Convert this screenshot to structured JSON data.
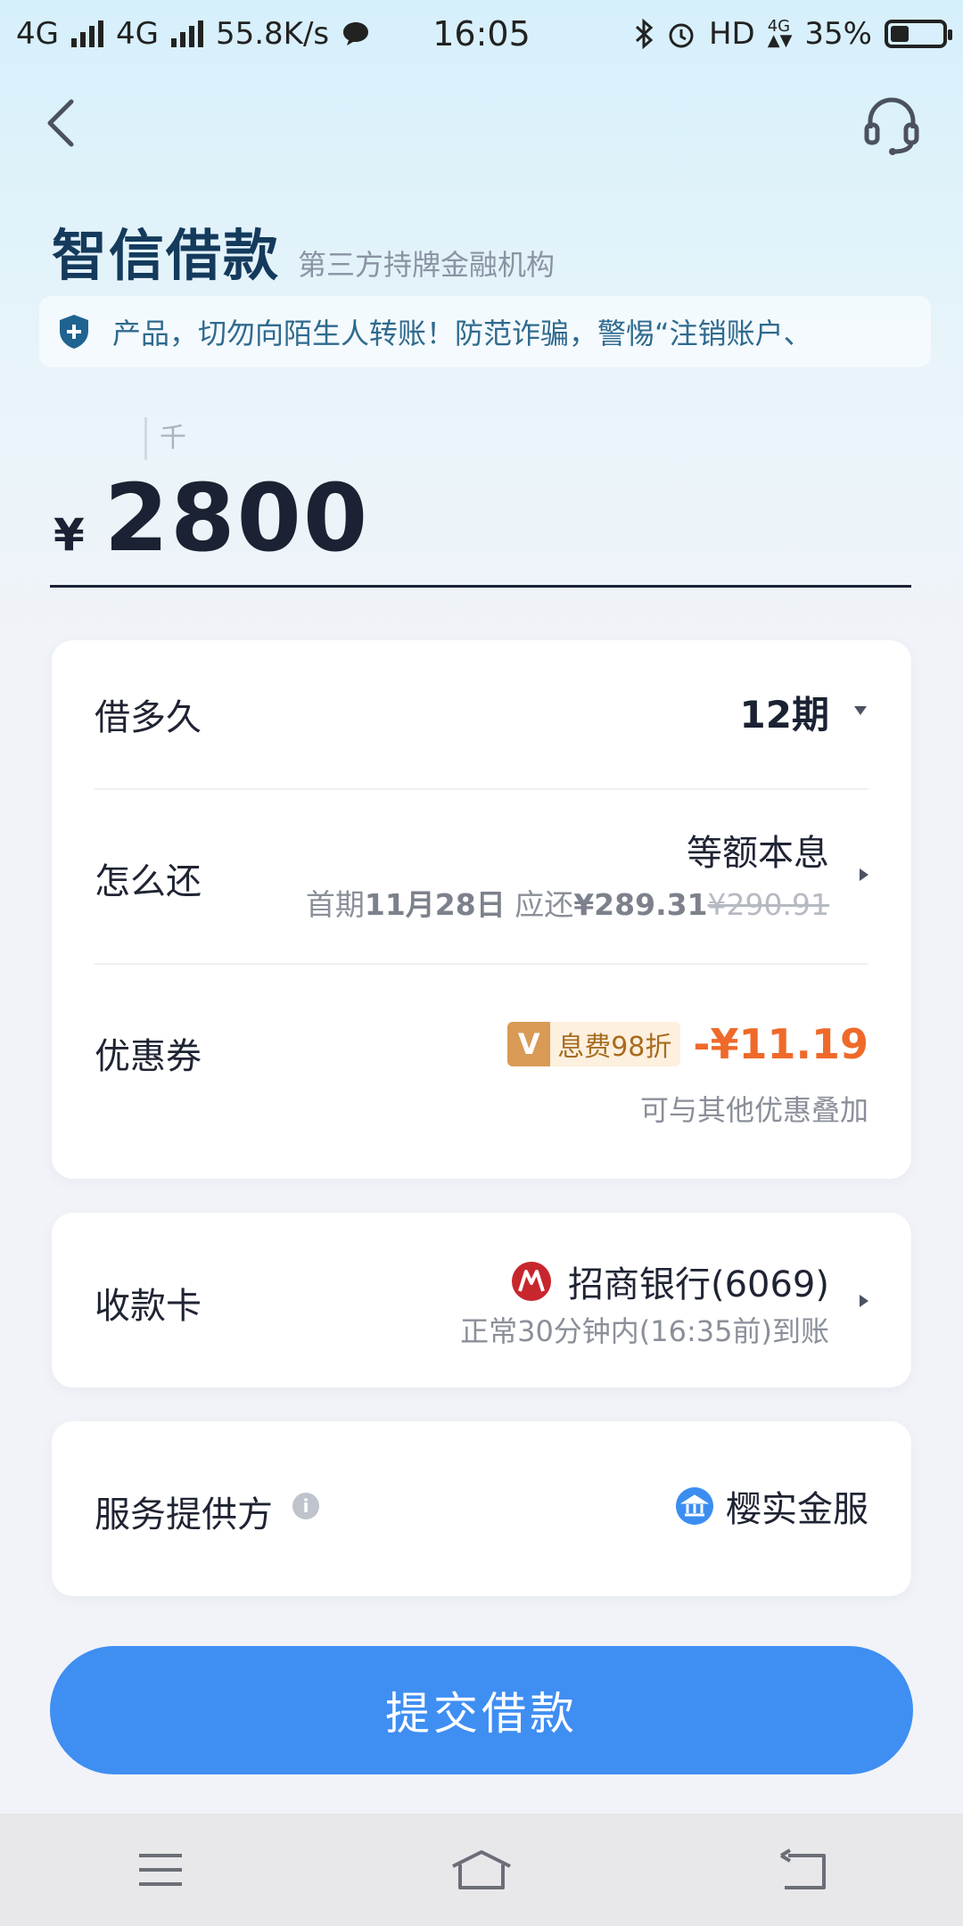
{
  "status_bar": {
    "network1": "4G",
    "network2": "4G",
    "speed": "55.8K/s",
    "time": "16:05",
    "hd": "HD",
    "battery_percent": "35%",
    "battery_level": 0.35
  },
  "header": {
    "back_icon": "chevron-left-icon",
    "support_icon": "headset-icon"
  },
  "title": {
    "main": "智信借款",
    "sub": "第三方持牌金融机构"
  },
  "notice": {
    "icon": "shield-plus-icon",
    "text": "产品，切勿向陌生人转账！防范诈骗，警惕“注销账户、"
  },
  "amount": {
    "unit_hint": "千",
    "currency": "¥",
    "value": "2800"
  },
  "loan_card": {
    "term": {
      "label": "借多久",
      "value": "12期"
    },
    "repay": {
      "label": "怎么还",
      "method": "等额本息",
      "first_prefix": "首期",
      "first_date": "11月28日",
      "due_prefix": "应还",
      "due_amount": "¥289.31",
      "original_amount": "¥290.91"
    },
    "coupon": {
      "label": "优惠券",
      "badge_letter": "V",
      "tag_text": "息费98折",
      "discount": "-¥11.19",
      "note": "可与其他优惠叠加"
    }
  },
  "receive_card": {
    "label": "收款卡",
    "bank_logo": "cmb-bank-logo",
    "bank_name": "招商银行(6069)",
    "arrival": "正常30分钟内(16:35前)到账"
  },
  "provider_card": {
    "label": "服务提供方",
    "info_icon": "info-icon",
    "provider_name": "樱实金服"
  },
  "submit_button": "提交借款",
  "nav": {
    "menu_icon": "menu-icon",
    "home_icon": "home-icon",
    "back_icon": "back-arrow-icon"
  },
  "colors": {
    "primary": "#3f8ef2",
    "title": "#143a5c",
    "discount": "#ef6a2a",
    "coupon_badge": "#d99a55"
  }
}
